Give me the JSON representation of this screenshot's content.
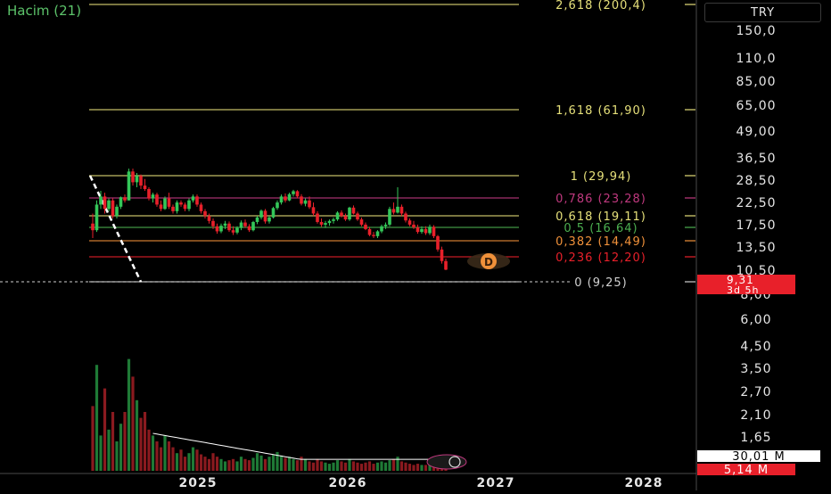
{
  "indicator": {
    "label": "Hacim (21)"
  },
  "currency": "TRY",
  "price_label": {
    "price": "9,31",
    "countdown": "3d 5h",
    "bg": "#e8202a"
  },
  "volume_labels": {
    "total": "30,01 M",
    "red": "5,14 M"
  },
  "center_badge": "D",
  "colors": {
    "up": "#34c759",
    "down": "#e8202a",
    "fib_yellow": "#e6e07a",
    "volume_ma": "#ffffff"
  },
  "chart_data": {
    "type": "candlestick",
    "y_scale": "log",
    "ylim": [
      5.2,
      210
    ],
    "y_ticks": [
      "150,0",
      "110,0",
      "85,00",
      "65,00",
      "49,00",
      "36,50",
      "28,50",
      "22,50",
      "17,50",
      "13,50",
      "10,50",
      "8,00",
      "6,00",
      "4,50",
      "3,50",
      "2,70",
      "2,10",
      "1,65"
    ],
    "x_ticks": [
      "2025",
      "2026",
      "2027",
      "2028"
    ],
    "fib_levels": [
      {
        "ratio": "2,618",
        "price": "200,4",
        "color": "#e6e07a"
      },
      {
        "ratio": "1,618",
        "price": "61,90",
        "color": "#e6e07a"
      },
      {
        "ratio": "1",
        "price": "29,94",
        "color": "#e6e07a"
      },
      {
        "ratio": "0,786",
        "price": "23,28",
        "color": "#c0397f"
      },
      {
        "ratio": "0,618",
        "price": "19,11",
        "color": "#e6e07a"
      },
      {
        "ratio": "0,5",
        "price": "16,64",
        "color": "#4caf50"
      },
      {
        "ratio": "0,382",
        "price": "14,49",
        "color": "#f0913a"
      },
      {
        "ratio": "0,236",
        "price": "12,20",
        "color": "#e8202a"
      },
      {
        "ratio": "0",
        "price": "9,25",
        "color": "#d0d0d0"
      }
    ],
    "candles": [
      [
        16.0,
        18.0,
        13.5,
        14.8
      ],
      [
        14.8,
        21.0,
        14.5,
        20.0
      ],
      [
        20.0,
        23.5,
        19.0,
        22.0
      ],
      [
        22.0,
        23.0,
        18.0,
        19.0
      ],
      [
        19.0,
        21.5,
        18.5,
        21.0
      ],
      [
        21.0,
        21.5,
        17.0,
        17.5
      ],
      [
        17.5,
        20.0,
        17.0,
        19.5
      ],
      [
        19.5,
        22.0,
        19.0,
        21.8
      ],
      [
        21.8,
        22.5,
        20.5,
        21.0
      ],
      [
        21.0,
        30.5,
        21.0,
        29.5
      ],
      [
        29.5,
        30.5,
        25.0,
        26.0
      ],
      [
        26.0,
        29.0,
        24.5,
        28.0
      ],
      [
        28.0,
        28.5,
        24.0,
        25.0
      ],
      [
        25.0,
        27.0,
        23.5,
        24.0
      ],
      [
        24.0,
        24.5,
        21.0,
        21.5
      ],
      [
        21.5,
        23.0,
        20.5,
        22.5
      ],
      [
        22.5,
        23.0,
        19.5,
        20.0
      ],
      [
        20.0,
        21.0,
        18.5,
        19.0
      ],
      [
        19.0,
        22.0,
        18.8,
        21.5
      ],
      [
        21.5,
        23.0,
        19.0,
        19.5
      ],
      [
        19.5,
        20.0,
        18.0,
        18.5
      ],
      [
        18.5,
        21.0,
        18.0,
        20.5
      ],
      [
        20.5,
        21.0,
        19.5,
        20.0
      ],
      [
        20.0,
        20.5,
        18.5,
        19.0
      ],
      [
        19.0,
        21.5,
        18.5,
        21.0
      ],
      [
        21.0,
        22.5,
        20.5,
        22.0
      ],
      [
        22.0,
        22.5,
        19.5,
        20.0
      ],
      [
        20.0,
        20.5,
        18.0,
        18.5
      ],
      [
        18.5,
        19.0,
        17.0,
        17.5
      ],
      [
        17.5,
        18.0,
        16.0,
        16.5
      ],
      [
        16.5,
        17.0,
        15.0,
        15.5
      ],
      [
        15.5,
        16.0,
        14.2,
        14.6
      ],
      [
        14.6,
        16.0,
        14.3,
        15.6
      ],
      [
        15.6,
        16.5,
        15.0,
        16.0
      ],
      [
        16.0,
        16.4,
        14.5,
        14.8
      ],
      [
        14.8,
        15.5,
        14.0,
        14.4
      ],
      [
        14.4,
        15.5,
        14.1,
        15.2
      ],
      [
        15.2,
        16.6,
        14.8,
        16.2
      ],
      [
        16.2,
        16.8,
        15.2,
        15.5
      ],
      [
        15.5,
        15.9,
        14.5,
        14.8
      ],
      [
        14.8,
        16.5,
        14.6,
        16.3
      ],
      [
        16.3,
        17.5,
        15.9,
        17.2
      ],
      [
        17.2,
        18.9,
        16.8,
        18.6
      ],
      [
        18.6,
        19.0,
        16.0,
        16.4
      ],
      [
        16.4,
        17.5,
        16.0,
        17.2
      ],
      [
        17.2,
        19.5,
        17.0,
        19.2
      ],
      [
        19.2,
        21.0,
        18.8,
        20.5
      ],
      [
        20.5,
        22.5,
        20.0,
        22.0
      ],
      [
        22.0,
        22.8,
        20.5,
        21.0
      ],
      [
        21.0,
        23.0,
        20.8,
        22.6
      ],
      [
        22.6,
        23.8,
        22.0,
        23.4
      ],
      [
        23.4,
        23.7,
        21.5,
        22.0
      ],
      [
        22.0,
        22.6,
        19.8,
        20.2
      ],
      [
        20.2,
        21.5,
        19.6,
        21.0
      ],
      [
        21.0,
        22.0,
        19.0,
        19.4
      ],
      [
        19.4,
        20.5,
        17.5,
        18.0
      ],
      [
        18.0,
        18.5,
        16.0,
        16.3
      ],
      [
        16.3,
        17.0,
        15.4,
        15.8
      ],
      [
        15.8,
        16.5,
        15.2,
        16.1
      ],
      [
        16.1,
        16.8,
        15.6,
        16.5
      ],
      [
        16.5,
        17.2,
        16.0,
        16.8
      ],
      [
        16.8,
        18.5,
        16.5,
        18.2
      ],
      [
        18.2,
        18.7,
        17.2,
        17.5
      ],
      [
        17.5,
        18.0,
        16.5,
        16.8
      ],
      [
        16.8,
        19.5,
        16.5,
        19.3
      ],
      [
        19.3,
        19.8,
        17.8,
        18.0
      ],
      [
        18.0,
        18.4,
        16.5,
        16.8
      ],
      [
        16.8,
        17.2,
        15.5,
        15.8
      ],
      [
        15.8,
        16.2,
        14.8,
        15.0
      ],
      [
        15.0,
        15.4,
        13.8,
        14.0
      ],
      [
        14.0,
        14.5,
        13.5,
        13.8
      ],
      [
        13.8,
        14.8,
        13.5,
        14.6
      ],
      [
        14.6,
        15.8,
        14.3,
        15.5
      ],
      [
        15.5,
        16.2,
        15.0,
        15.8
      ],
      [
        15.8,
        19.5,
        15.5,
        19.0
      ],
      [
        19.0,
        20.5,
        17.8,
        18.2
      ],
      [
        18.2,
        24.5,
        18.0,
        19.5
      ],
      [
        19.5,
        20.0,
        17.5,
        18.0
      ],
      [
        18.0,
        18.4,
        16.2,
        16.6
      ],
      [
        16.6,
        17.0,
        15.5,
        15.8
      ],
      [
        15.8,
        16.5,
        15.0,
        15.3
      ],
      [
        15.3,
        15.8,
        14.2,
        14.5
      ],
      [
        14.5,
        15.5,
        14.2,
        15.0
      ],
      [
        15.0,
        15.5,
        14.0,
        14.3
      ],
      [
        14.3,
        15.8,
        14.0,
        15.4
      ],
      [
        15.4,
        15.7,
        13.5,
        13.8
      ],
      [
        13.8,
        14.0,
        11.5,
        11.8
      ],
      [
        11.8,
        12.2,
        10.0,
        10.3
      ],
      [
        10.3,
        10.6,
        9.25,
        9.31
      ]
    ],
    "volume_labels_x": [
      "2025",
      "2026",
      "2027",
      "2028"
    ]
  }
}
